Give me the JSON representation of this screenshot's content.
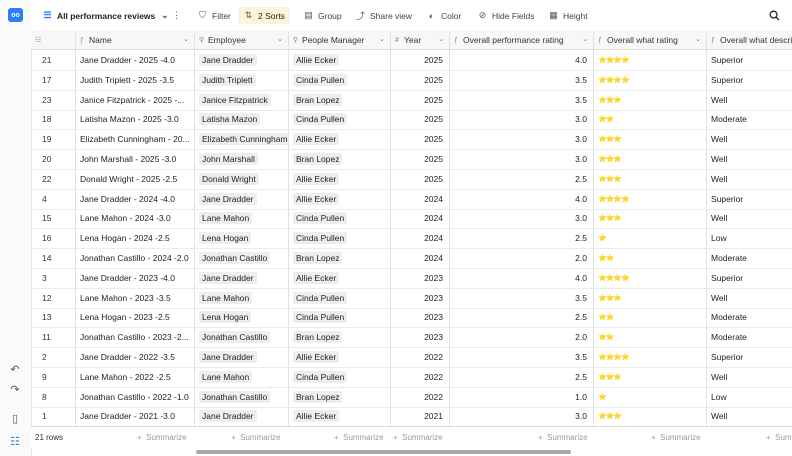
{
  "rail": {
    "logo": "oo",
    "icons": [
      "undo-icon",
      "redo-icon",
      "sidebar-icon",
      "views-icon"
    ]
  },
  "toolbar": {
    "view_name": "All performance reviews",
    "filter": "Filter",
    "sorts": "2 Sorts",
    "group": "Group",
    "share": "Share view",
    "color": "Color",
    "hide": "Hide Fields",
    "height": "Height"
  },
  "columns": [
    {
      "label": "Name",
      "type_icon": "lookup-icon"
    },
    {
      "label": "Employee",
      "type_icon": "link-icon"
    },
    {
      "label": "People Manager",
      "type_icon": "link-icon"
    },
    {
      "label": "Year",
      "type_icon": "number-icon"
    },
    {
      "label": "Overall performance rating",
      "type_icon": "lookup-icon"
    },
    {
      "label": "Overall what rating",
      "type_icon": "lookup-icon"
    },
    {
      "label": "Overall what descri",
      "type_icon": "lookup-icon"
    }
  ],
  "rows": [
    {
      "id": "21",
      "name": "Jane Dradder - 2025 -4.0",
      "employee": "Jane Dradder",
      "manager": "Allie Ecker",
      "year": "2025",
      "rating": "4.0",
      "stars": "⭐⭐⭐⭐",
      "desc": "Superior"
    },
    {
      "id": "17",
      "name": "Judith Triplett - 2025 -3.5",
      "employee": "Judith Triplett",
      "manager": "Cinda Pullen",
      "year": "2025",
      "rating": "3.5",
      "stars": "⭐⭐⭐⭐",
      "desc": "Superior"
    },
    {
      "id": "23",
      "name": "Janice Fitzpatrick - 2025 -...",
      "employee": "Janice Fitzpatrick",
      "manager": "Bran Lopez",
      "year": "2025",
      "rating": "3.5",
      "stars": "⭐⭐⭐",
      "desc": "Well"
    },
    {
      "id": "18",
      "name": "Latisha Mazon - 2025 -3.0",
      "employee": "Latisha Mazon",
      "manager": "Cinda Pullen",
      "year": "2025",
      "rating": "3.0",
      "stars": "⭐⭐",
      "desc": "Moderate"
    },
    {
      "id": "19",
      "name": "Elizabeth Cunningham - 20...",
      "employee": "Elizabeth Cunningham",
      "manager": "Allie Ecker",
      "year": "2025",
      "rating": "3.0",
      "stars": "⭐⭐⭐",
      "desc": "Well"
    },
    {
      "id": "20",
      "name": "John Marshall - 2025 -3.0",
      "employee": "John Marshall",
      "manager": "Bran Lopez",
      "year": "2025",
      "rating": "3.0",
      "stars": "⭐⭐⭐",
      "desc": "Well"
    },
    {
      "id": "22",
      "name": "Donald Wright - 2025 -2.5",
      "employee": "Donald Wright",
      "manager": "Allie Ecker",
      "year": "2025",
      "rating": "2.5",
      "stars": "⭐⭐⭐",
      "desc": "Well"
    },
    {
      "id": "4",
      "name": "Jane Dradder - 2024 -4.0",
      "employee": "Jane Dradder",
      "manager": "Allie Ecker",
      "year": "2024",
      "rating": "4.0",
      "stars": "⭐⭐⭐⭐",
      "desc": "Superior"
    },
    {
      "id": "15",
      "name": "Lane Mahon - 2024 -3.0",
      "employee": "Lane Mahon",
      "manager": "Cinda Pullen",
      "year": "2024",
      "rating": "3.0",
      "stars": "⭐⭐⭐",
      "desc": "Well"
    },
    {
      "id": "16",
      "name": "Lena Hogan - 2024 -2.5",
      "employee": "Lena Hogan",
      "manager": "Cinda Pullen",
      "year": "2024",
      "rating": "2.5",
      "stars": "⭐",
      "desc": "Low"
    },
    {
      "id": "14",
      "name": "Jonathan Castillo - 2024 -2.0",
      "employee": "Jonathan Castillo",
      "manager": "Bran Lopez",
      "year": "2024",
      "rating": "2.0",
      "stars": "⭐⭐",
      "desc": "Moderate"
    },
    {
      "id": "3",
      "name": "Jane Dradder - 2023 -4.0",
      "employee": "Jane Dradder",
      "manager": "Allie Ecker",
      "year": "2023",
      "rating": "4.0",
      "stars": "⭐⭐⭐⭐",
      "desc": "Superior"
    },
    {
      "id": "12",
      "name": "Lane Mahon - 2023 -3.5",
      "employee": "Lane Mahon",
      "manager": "Cinda Pullen",
      "year": "2023",
      "rating": "3.5",
      "stars": "⭐⭐⭐",
      "desc": "Well"
    },
    {
      "id": "13",
      "name": "Lena Hogan - 2023 -2.5",
      "employee": "Lena Hogan",
      "manager": "Cinda Pullen",
      "year": "2023",
      "rating": "2.5",
      "stars": "⭐⭐",
      "desc": "Moderate"
    },
    {
      "id": "11",
      "name": "Jonathan Castillo - 2023 -2...",
      "employee": "Jonathan Castillo",
      "manager": "Bran Lopez",
      "year": "2023",
      "rating": "2.0",
      "stars": "⭐⭐",
      "desc": "Moderate"
    },
    {
      "id": "2",
      "name": "Jane Dradder - 2022 -3.5",
      "employee": "Jane Dradder",
      "manager": "Allie Ecker",
      "year": "2022",
      "rating": "3.5",
      "stars": "⭐⭐⭐⭐",
      "desc": "Superior"
    },
    {
      "id": "9",
      "name": "Lane Mahon - 2022 -2.5",
      "employee": "Lane Mahon",
      "manager": "Cinda Pullen",
      "year": "2022",
      "rating": "2.5",
      "stars": "⭐⭐⭐",
      "desc": "Well"
    },
    {
      "id": "8",
      "name": "Jonathan Castillo - 2022 -1.0",
      "employee": "Jonathan Castillo",
      "manager": "Bran Lopez",
      "year": "2022",
      "rating": "1.0",
      "stars": "⭐",
      "desc": "Low"
    },
    {
      "id": "1",
      "name": "Jane Dradder - 2021 -3.0",
      "employee": "Jane Dradder",
      "manager": "Allie Ecker",
      "year": "2021",
      "rating": "3.0",
      "stars": "⭐⭐⭐",
      "desc": "Well"
    }
  ],
  "footer": {
    "row_count": "21 rows",
    "summarize": "Summarize"
  }
}
